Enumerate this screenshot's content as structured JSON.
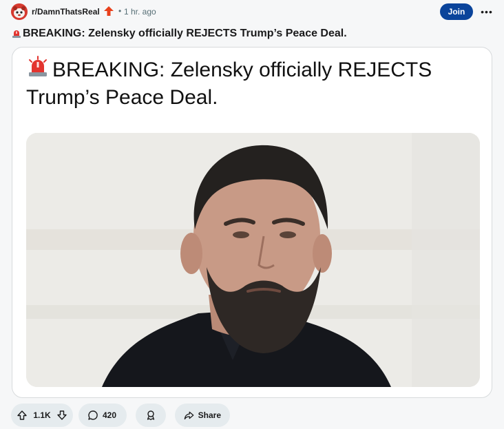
{
  "header": {
    "subreddit": "r/DamnThatsReal",
    "separator": "•",
    "time": "1 hr. ago",
    "join_label": "Join",
    "more_label": "•••"
  },
  "post": {
    "title": "BREAKING: Zelensky officially REJECTS Trump’s Peace Deal.",
    "title_emoji": "siren-icon"
  },
  "card": {
    "text": "BREAKING: Zelensky officially REJECTS Trump’s Peace Deal.",
    "image_subject": "portrait-photo"
  },
  "actions": {
    "upvotes": "1.1K",
    "comments": "420",
    "share_label": "Share"
  },
  "colors": {
    "join_bg": "#0a449b",
    "pill_bg": "#e5ebee",
    "avatar_bg": "#d63a2f",
    "boost_icon": "#e8401c",
    "siren": "#e3342f"
  }
}
